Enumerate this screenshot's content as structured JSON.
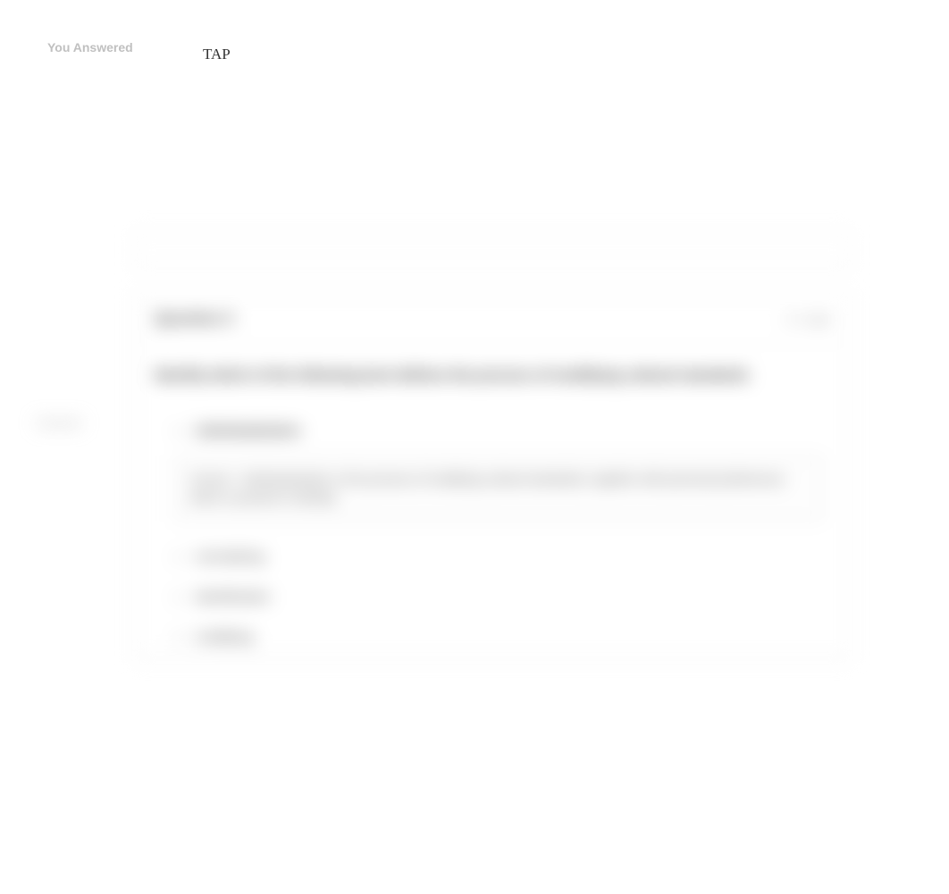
{
  "top": {
    "you_answered": "You Answered",
    "tap": "TAP"
  },
  "blurred": {
    "question_header": "Question 3",
    "points": "1 / 1 pts",
    "question_text": "Identify which of the following best defines the process of modifying cultural standards",
    "correct_label": "Correct!",
    "option1": "individualization",
    "feedback": "Correct - Individualization is the process of modifying cultural standards, together with personal preferences which is present in identity.",
    "option2": "normalizing",
    "option3": "identification",
    "option4": "modifying"
  }
}
